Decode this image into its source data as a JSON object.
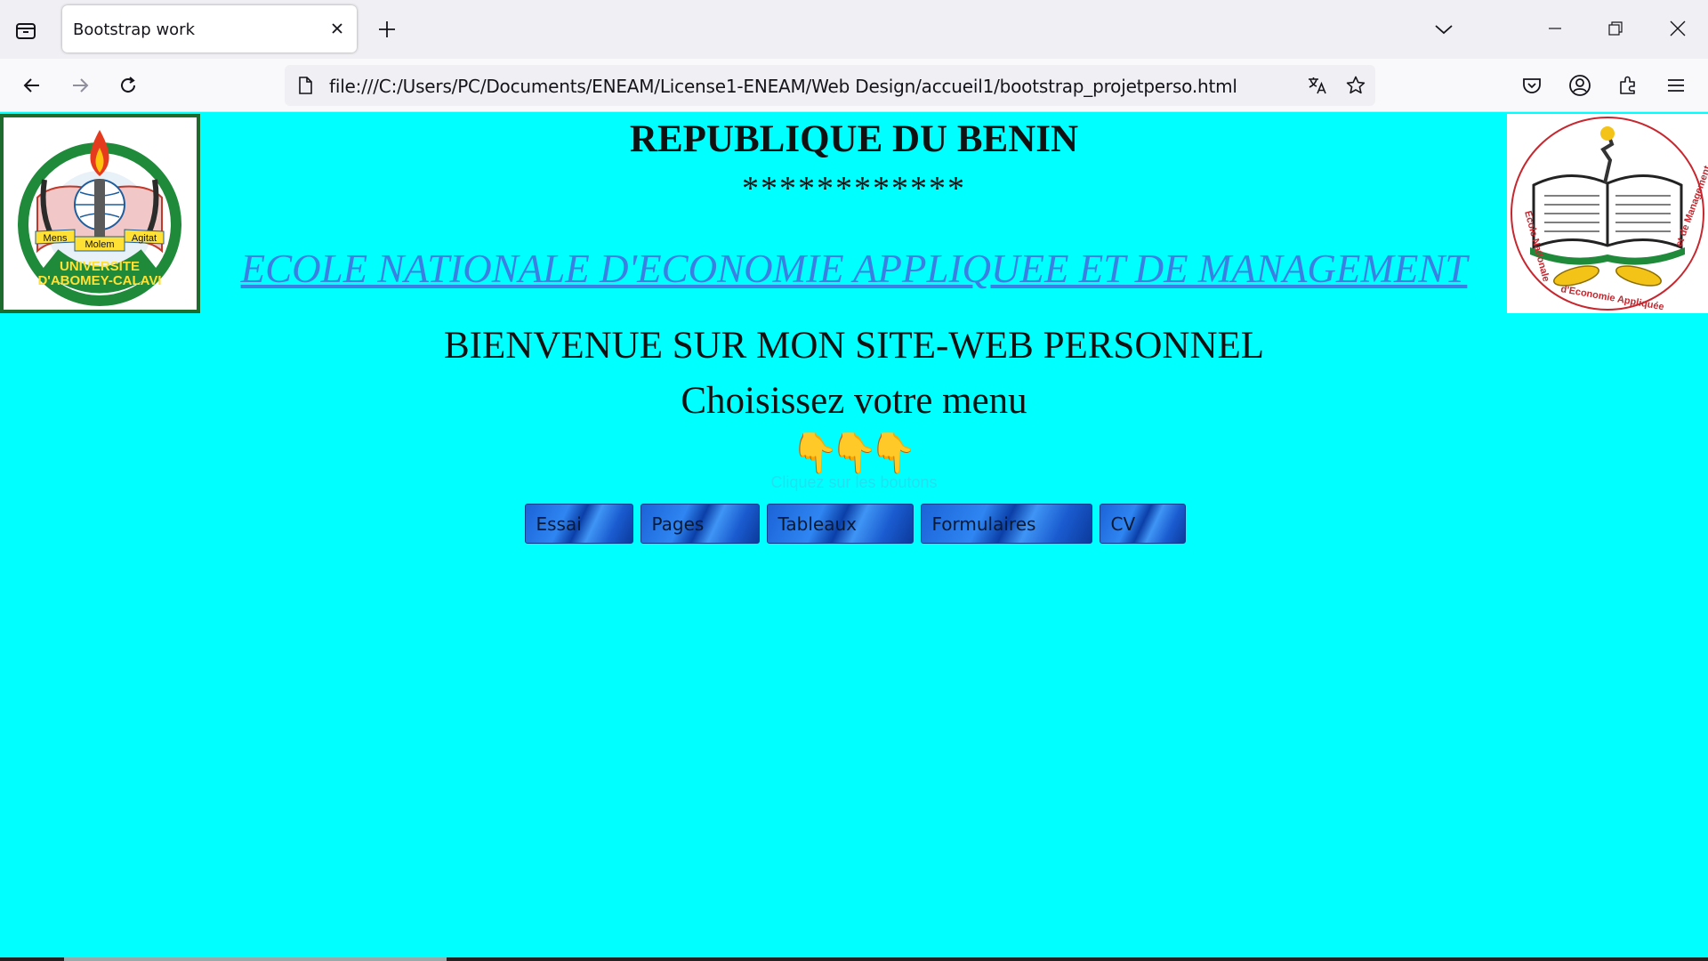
{
  "browser": {
    "tab_title": "Bootstrap work",
    "url": "file:///C:/Users/PC/Documents/ENEAM/License1-ENEAM/Web Design/accueil1/bootstrap_projetperso.html",
    "icons": {
      "tab_list": "tab-list-icon",
      "close_tab": "close-icon",
      "new_tab": "plus-icon",
      "tab_overflow": "chevron-down-icon",
      "back": "arrow-left-icon",
      "forward": "arrow-right-icon",
      "reload": "reload-icon",
      "page": "page-icon",
      "translate": "translate-icon",
      "bookmark": "star-icon",
      "pocket": "pocket-icon",
      "account": "account-icon",
      "extensions": "puzzle-icon",
      "menu": "hamburger-icon",
      "minimize": "minimize-icon",
      "restore": "restore-icon",
      "close_window": "close-icon"
    }
  },
  "page": {
    "background": "#00ffff",
    "republic": "REPUBLIQUE DU BENIN",
    "stars": "************",
    "school": "ECOLE NATIONALE D'ECONOMIE APPLIQUEE ET DE MANAGEMENT",
    "welcome": "BIENVENUE SUR MON SITE-WEB PERSONNEL",
    "choose": "Choisissez votre menu",
    "hand_emoji": "👇",
    "faint_text": "Cliquez sur les boutons",
    "logo_left": {
      "name": "UNIVERSITE D'ABOMEY-CALAVI",
      "ribbon_left": "Mens",
      "ribbon_mid": "Molem",
      "ribbon_right": "Agitat"
    },
    "logo_right": {
      "name": "Ecole Nationale d'Economie Appliquée et de Management"
    },
    "menu": [
      "Essai",
      "Pages",
      "Tableaux",
      "Formulaires",
      "CV"
    ]
  }
}
